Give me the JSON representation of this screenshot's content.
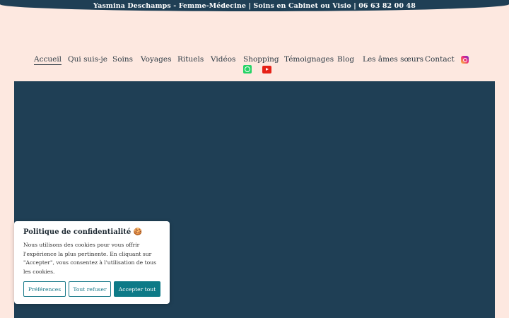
{
  "topbar": {
    "text": "Yasmina Deschamps - Femme-Médecine | Soins en Cabinet ou Visio | 06 63 82 00 48"
  },
  "nav": {
    "items": [
      {
        "label": "Accueil",
        "active": true
      },
      {
        "label": "Qui suis-je"
      },
      {
        "label": "Soins"
      },
      {
        "label": "Voyages"
      },
      {
        "label": "Rituels"
      },
      {
        "label": "Vidéos"
      },
      {
        "label": "Shopping"
      },
      {
        "label": "Témoignages"
      },
      {
        "label": "Blog"
      },
      {
        "label": "Les âmes sœurs"
      },
      {
        "label": "Contact"
      }
    ],
    "icons": [
      "instagram-icon",
      "whatsapp-icon",
      "youtube-icon"
    ]
  },
  "hero": {
    "background_color": "#1f3f55"
  },
  "cookie": {
    "title": "Politique de confidentialité 🍪",
    "text": "Nous utilisons des cookies pour vous offrir l'expérience la plus pertinente. En cliquant sur \"Accepter\", vous consentez à l'utilisation de tous les cookies.",
    "buttons": {
      "preferences": "Préférences",
      "reject": "Tout refuser",
      "accept": "Accepter tout"
    },
    "accent_color": "#0d7a87"
  },
  "colors": {
    "page_background": "#fde8e0",
    "topbar_background": "#1f3f55"
  }
}
